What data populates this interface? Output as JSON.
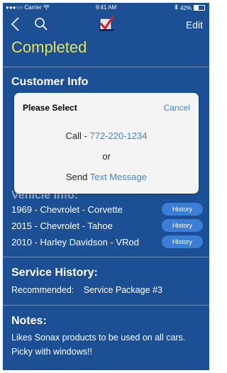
{
  "status_bar": {
    "carrier": "Carrier",
    "time": "9:41 AM",
    "battery": "42%",
    "battery_level": 0.42
  },
  "nav": {
    "edit_label": "Edit",
    "back_icon": "chevron-left-icon",
    "search_icon": "search-icon",
    "logo_icon": "checkmark-logo-icon"
  },
  "status_title": "Completed",
  "customer_info": {
    "title": "Customer Info"
  },
  "vehicle_info": {
    "title": "Vehicle Info:",
    "vehicles": [
      {
        "label": "1969 - Chevrolet - Corvette",
        "button": "History"
      },
      {
        "label": "2015 - Chevrolet - Tahoe",
        "button": "History"
      },
      {
        "label": "2010 - Harley Davidson - VRod",
        "button": "History"
      }
    ]
  },
  "service_history": {
    "title": "Service History:",
    "recommended_label": "Recommended:",
    "recommended_value": "Service Package #3"
  },
  "notes": {
    "title": "Notes:",
    "text": "Likes Sonax products to be used on all cars. Picky with windows!!"
  },
  "dialog": {
    "title": "Please Select",
    "cancel": "Cancel",
    "call_prefix": "Call - ",
    "phone": "772-220-1234",
    "or": "or",
    "send_prefix": "Send ",
    "send_link": "Text Message"
  },
  "colors": {
    "background": "#1c4f93",
    "accent": "#e6e25a",
    "button": "#3a7fd5",
    "link": "#3e86d6"
  }
}
